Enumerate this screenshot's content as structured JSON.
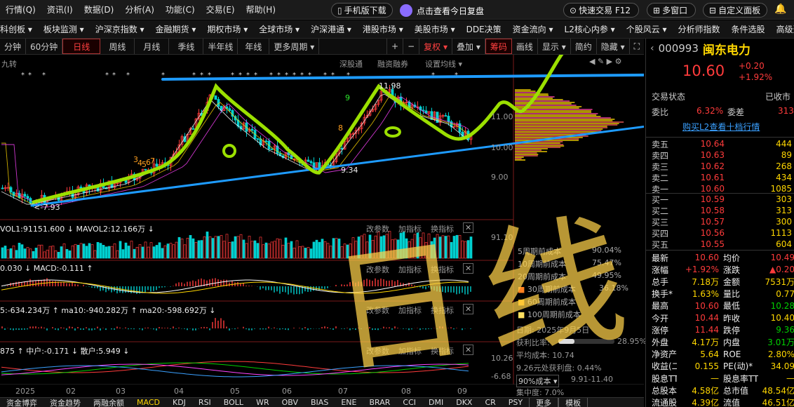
{
  "menubar": {
    "items": [
      "行情(Q)",
      "资讯(I)",
      "数据(D)",
      "分析(A)",
      "功能(C)",
      "交易(E)",
      "帮助(H)"
    ],
    "mobile_download": "手机版下载",
    "daily_review": "点击查看今日复盘",
    "quick_trade": "快速交易 F12",
    "multi_window": "多窗口",
    "custom_panel": "自定义面板"
  },
  "navbar": {
    "items": [
      "科创板 ▾",
      "板块监测 ▾",
      "沪深京指数 ▾",
      "金融期货 ▾",
      "期权市场 ▾",
      "全球市场 ▾",
      "沪深港通 ▾",
      "港股市场 ▾",
      "美股市场 ▾",
      "DDE决策",
      "资金流向 ▾",
      "L2核心内参 ▾",
      "个股风云 ▾",
      "分析师指数",
      "条件选股",
      "高级选股"
    ]
  },
  "periodbar": {
    "items": [
      "分钟",
      "60分钟",
      "日线",
      "周线",
      "月线",
      "季线",
      "半年线",
      "年线",
      "更多周期 ▾"
    ],
    "selected": "日线",
    "tools": [
      "+",
      "−",
      "复权 ▾",
      "叠加 ▾",
      "筹码",
      "画线",
      "显示 ▾",
      "简约",
      "隐藏 ▾"
    ]
  },
  "chart": {
    "indicator_name": "九转",
    "top_links": [
      "深股通",
      "融资融券",
      "设置均线 ▾"
    ],
    "high_label": "11.98",
    "low_label": "<-7.93",
    "mid_low_label": "9.34",
    "price_axis": [
      "11.00",
      "10.00",
      "9.00"
    ],
    "nine_labels": [
      "3",
      "4",
      "5",
      "6",
      "7",
      "8",
      "9"
    ],
    "annotation_zero_1": "0",
    "annotation_zero_2": "0",
    "vol_line": "VOL1:91151.600 ↓ MAVOL2:12.166万 ↓",
    "vol_axis": "91.10",
    "macd_line": "0.030 ↓ MACD:-0.111 ↑",
    "ma_line": "5:-634.234万 ↑ ma10:-940.282万 ↑ ma20:-598.692万 ↓",
    "fund_line": "875 ↑ 中户:-0.171 ↓ 散户:5.949 ↓",
    "fund_axis": [
      "10.26",
      "-6.68"
    ],
    "panel_tools": [
      "改参数",
      "加指标",
      "换指标"
    ],
    "close_icon": "✕",
    "dates": [
      "2025",
      "02",
      "03",
      "04",
      "05",
      "06",
      "07",
      "08",
      "09"
    ],
    "handwriting": "日线"
  },
  "chip_panel": {
    "rows": [
      {
        "label": "5周期前成本",
        "value": "90.04%"
      },
      {
        "label": "10周期前成本",
        "value": "75.47%"
      },
      {
        "label": "20周期前成本",
        "value": "49.95%"
      },
      {
        "label": "30周期前成本",
        "value": "36.18%"
      },
      {
        "label": "60周期前成本",
        "value": ""
      },
      {
        "label": "100周期前成本",
        "value": ""
      }
    ],
    "date": "日期: 2025年9月5日",
    "profit_ratio_label": "获利比率:",
    "profit_ratio": "28.95%",
    "avg_cost": "平均成本: 10.74",
    "profit_line": "9.26元处获利盘: 0.44%",
    "cost_select": "90%成本 ▾",
    "cost_range": "9.91-11.40",
    "concentration": "集中度: 7.0%"
  },
  "quote": {
    "code": "000993",
    "name": "闽东电力",
    "price": "10.60",
    "change": "+0.20",
    "change_pct": "+1.92%",
    "status_label": "交易状态",
    "status_value": "已收市",
    "weibi_label": "委比",
    "weibi_value": "6.32%",
    "weicha_label": "委差",
    "weicha_value": "313",
    "l2_link": "购买L2查看十档行情",
    "sell": [
      {
        "label": "卖五",
        "price": "10.64",
        "vol": "444"
      },
      {
        "label": "卖四",
        "price": "10.63",
        "vol": "89"
      },
      {
        "label": "卖三",
        "price": "10.62",
        "vol": "268"
      },
      {
        "label": "卖二",
        "price": "10.61",
        "vol": "434"
      },
      {
        "label": "卖一",
        "price": "10.60",
        "vol": "1085"
      }
    ],
    "buy": [
      {
        "label": "买一",
        "price": "10.59",
        "vol": "303"
      },
      {
        "label": "买二",
        "price": "10.58",
        "vol": "313"
      },
      {
        "label": "买三",
        "price": "10.57",
        "vol": "300"
      },
      {
        "label": "买四",
        "price": "10.56",
        "vol": "1113"
      },
      {
        "label": "买五",
        "price": "10.55",
        "vol": "604"
      }
    ],
    "stats": [
      {
        "l1": "最新",
        "v1": "10.60",
        "l2": "均价",
        "v2": "10.49"
      },
      {
        "l1": "涨幅",
        "v1": "+1.92%",
        "l2": "涨跌",
        "v2": "▲0.20"
      },
      {
        "l1": "总手",
        "v1": "7.18万",
        "l2": "金额",
        "v2": "7531万"
      },
      {
        "l1": "换手*",
        "v1": "1.63%",
        "l2": "量比",
        "v2": "0.77"
      },
      {
        "l1": "最高",
        "v1": "10.60",
        "l2": "最低",
        "v2": "10.28"
      },
      {
        "l1": "今开",
        "v1": "10.44",
        "l2": "昨收",
        "v2": "10.40"
      },
      {
        "l1": "涨停",
        "v1": "11.44",
        "l2": "跌停",
        "v2": "9.36"
      },
      {
        "l1": "外盘",
        "v1": "4.17万",
        "l2": "内盘",
        "v2": "3.01万"
      },
      {
        "l1": "净资产",
        "v1": "5.64",
        "l2": "ROE",
        "v2": "2.80%"
      },
      {
        "l1": "收益(二)",
        "v1": "0.155",
        "l2": "PE(动)*",
        "v2": "34.09"
      },
      {
        "l1": "股息TTM",
        "v1": "—",
        "l2": "股息率TTM",
        "v2": "—"
      },
      {
        "l1": "总股本",
        "v1": "4.58亿",
        "l2": "总市值",
        "v2": "48.54亿"
      },
      {
        "l1": "流通股",
        "v1": "4.39亿",
        "l2": "流值",
        "v2": "46.51亿"
      }
    ]
  },
  "bottombar": {
    "items": [
      "资金博弈",
      "资金趋势",
      "两融余额",
      "MACD",
      "KDJ",
      "RSI",
      "BOLL",
      "WR",
      "OBV",
      "BIAS",
      "ENE",
      "BRAR",
      "CCI",
      "DMI",
      "DKX",
      "CR",
      "PSY",
      "更多",
      "模板"
    ]
  },
  "colors": {
    "up": "#ff3b3b",
    "down": "#00d0d0",
    "annotation_green": "#9be000",
    "annotation_blue": "#1e9bff",
    "handwriting": "#ffd24a"
  }
}
